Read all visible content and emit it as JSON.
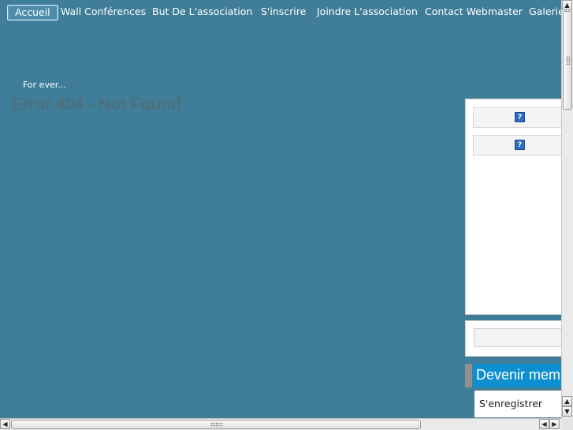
{
  "nav": {
    "items": [
      {
        "label": "Accueil",
        "active": true
      },
      {
        "label": "Wall Conférences"
      },
      {
        "label": "But De L'association"
      },
      {
        "label": "S'inscrire"
      },
      {
        "label": "Joindre L'association"
      },
      {
        "label": "Contact Webmaster"
      },
      {
        "label": "Galerie"
      }
    ]
  },
  "header": {
    "tagline": "For ever..."
  },
  "main": {
    "error_title": "Error 404 - Not Found"
  },
  "sidebar": {
    "widget_icons": [
      "question-icon",
      "question-icon"
    ],
    "icon_glyph": "?",
    "search": {
      "value": "",
      "placeholder": ""
    },
    "member": {
      "title": "Devenir membre",
      "register_label": "S'enregistrer"
    }
  },
  "colors": {
    "page_background": "#3f7d98",
    "member_title_bg": "#0d8fd1",
    "error_title": "#4f6e7c"
  }
}
